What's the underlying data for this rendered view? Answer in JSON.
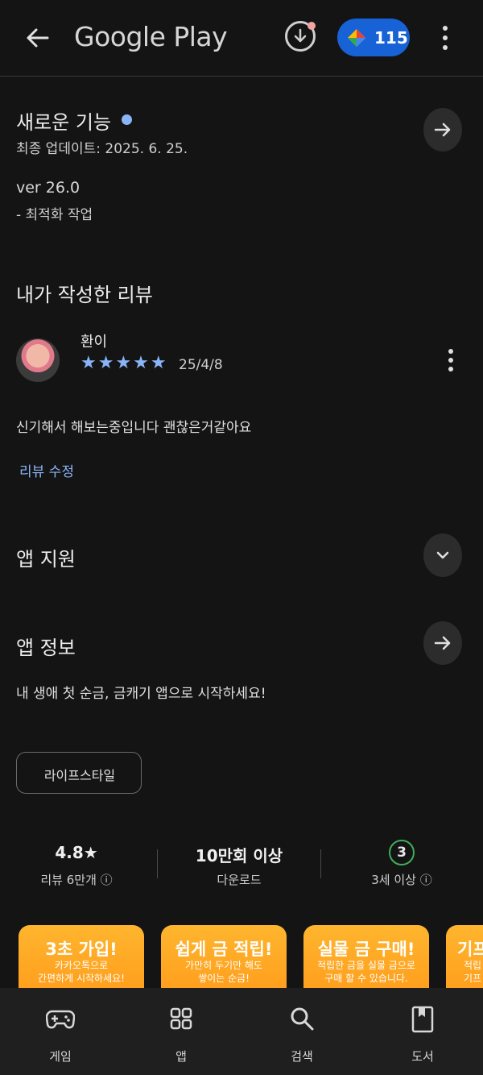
{
  "header": {
    "brand": "Google Play",
    "points": "115"
  },
  "whats_new": {
    "title": "새로운 기능",
    "updated": "최종 업데이트: 2025. 6. 25.",
    "version": "ver 26.0",
    "note": "- 최적화 작업"
  },
  "my_review": {
    "title": "내가 작성한 리뷰",
    "author": "환이",
    "rating": 5,
    "stars": "★★★★★",
    "date": "25/4/8",
    "text": "신기해서 해보는중입니다 괜찮은거같아요",
    "edit_label": "리뷰 수정"
  },
  "app_support": {
    "title": "앱 지원"
  },
  "app_info": {
    "title": "앱 정보",
    "description": "내 생애 첫 순금, 금캐기 앱으로 시작하세요!",
    "category": "라이프스타일"
  },
  "stats": [
    {
      "value": "4.8★",
      "label": "리뷰 6만개 ⓘ"
    },
    {
      "value": "10만회 이상",
      "label": "다운로드"
    },
    {
      "value": "3",
      "label": "3세 이상 ⓘ"
    }
  ],
  "promos": [
    {
      "title": "3초 가입!",
      "sub1": "카카오톡으로",
      "sub2": "간편하게 시작하세요!"
    },
    {
      "title": "쉽게 금 적립!",
      "sub1": "가만히 두기만 해도",
      "sub2": "쌓이는 순금!"
    },
    {
      "title": "실물 금 구매!",
      "sub1": "적립한 금을 실물 금으로",
      "sub2": "구매 할 수 있습니다."
    },
    {
      "title": "기프",
      "sub1": "적립",
      "sub2": "기프"
    }
  ],
  "nav": [
    {
      "label": "게임",
      "icon": "gamepad-icon"
    },
    {
      "label": "앱",
      "icon": "apps-grid-icon"
    },
    {
      "label": "검색",
      "icon": "search-icon"
    },
    {
      "label": "도서",
      "icon": "book-icon"
    }
  ],
  "colors": {
    "background": "#141414",
    "accent_blue": "#8ab4f8",
    "points_pill": "#1762d6",
    "promo_orange": "#ff9a1a",
    "age_green": "#3fae5a"
  }
}
